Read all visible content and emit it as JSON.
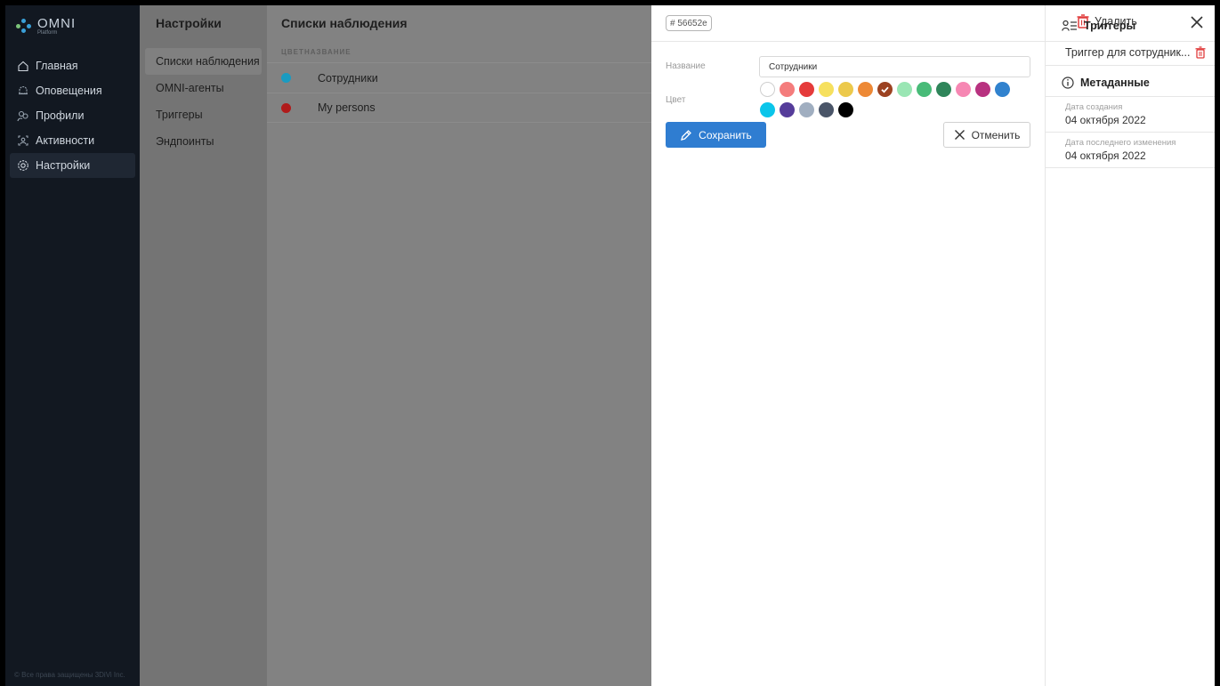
{
  "brand": {
    "name": "OMNI",
    "sub": "Platform"
  },
  "sidebar": {
    "items": [
      {
        "label": "Главная",
        "icon": "home-icon"
      },
      {
        "label": "Оповещения",
        "icon": "bell-icon"
      },
      {
        "label": "Профили",
        "icon": "profiles-icon"
      },
      {
        "label": "Активности",
        "icon": "activity-icon"
      },
      {
        "label": "Настройки",
        "icon": "gear-icon",
        "active": true
      }
    ],
    "footer": "© Все права защищены 3DiVi Inc."
  },
  "settings": {
    "title": "Настройки",
    "items": [
      {
        "label": "Списки наблюдения",
        "active": true
      },
      {
        "label": "OMNI-агенты"
      },
      {
        "label": "Триггеры"
      },
      {
        "label": "Эндпоинты"
      }
    ]
  },
  "watchlists": {
    "title": "Списки наблюдения",
    "columns": {
      "color": "ЦВЕТ",
      "name": "НАЗВАНИЕ"
    },
    "rows": [
      {
        "name": "Сотрудники",
        "color": "#1a9bc1"
      },
      {
        "name": "My persons",
        "color": "#b01b1b"
      }
    ]
  },
  "editor": {
    "id_tag": "# 56652e",
    "delete_label": "Удалить",
    "name_label": "Название",
    "name_value": "Сотрудники",
    "color_label": "Цвет",
    "colors": [
      "#ffffff",
      "#f47c7c",
      "#e53b3b",
      "#f6e05e",
      "#ecc94b",
      "#ed8936",
      "#9c4221",
      "#9ae6b4",
      "#48bb78",
      "#2f855a",
      "#f687b3",
      "#b83280",
      "#3182ce",
      "#0bc5ea",
      "#553c9a",
      "#a0aec0",
      "#4a5568",
      "#000000"
    ],
    "selected_color": "#9c4221",
    "save_label": "Сохранить",
    "cancel_label": "Отменить"
  },
  "side": {
    "triggers_title": "Триггеры",
    "triggers": [
      "Триггер для сотрудник..."
    ],
    "metadata_title": "Метаданные",
    "created_label": "Дата создания",
    "created_value": "04 октября 2022",
    "modified_label": "Дата последнего изменения",
    "modified_value": "04 октября 2022"
  }
}
